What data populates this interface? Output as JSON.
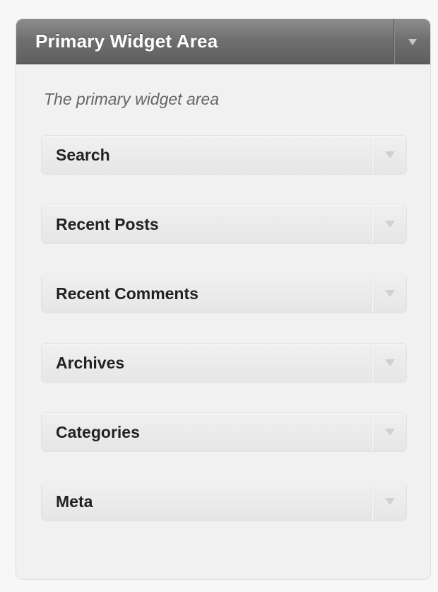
{
  "sidebar": {
    "title": "Primary Widget Area",
    "description": "The primary widget area",
    "widgets": [
      {
        "label": "Search"
      },
      {
        "label": "Recent Posts"
      },
      {
        "label": "Recent Comments"
      },
      {
        "label": "Archives"
      },
      {
        "label": "Categories"
      },
      {
        "label": "Meta"
      }
    ]
  },
  "icons": {
    "header_toggle": "triangle-down-icon",
    "widget_toggle": "triangle-down-icon"
  },
  "colors": {
    "header_bg": "#6e6e6e",
    "header_text": "#ffffff",
    "panel_bg": "#f1f1f1",
    "widget_bg": "#e9e9e9",
    "widget_text": "#222222",
    "description_text": "#666666"
  }
}
